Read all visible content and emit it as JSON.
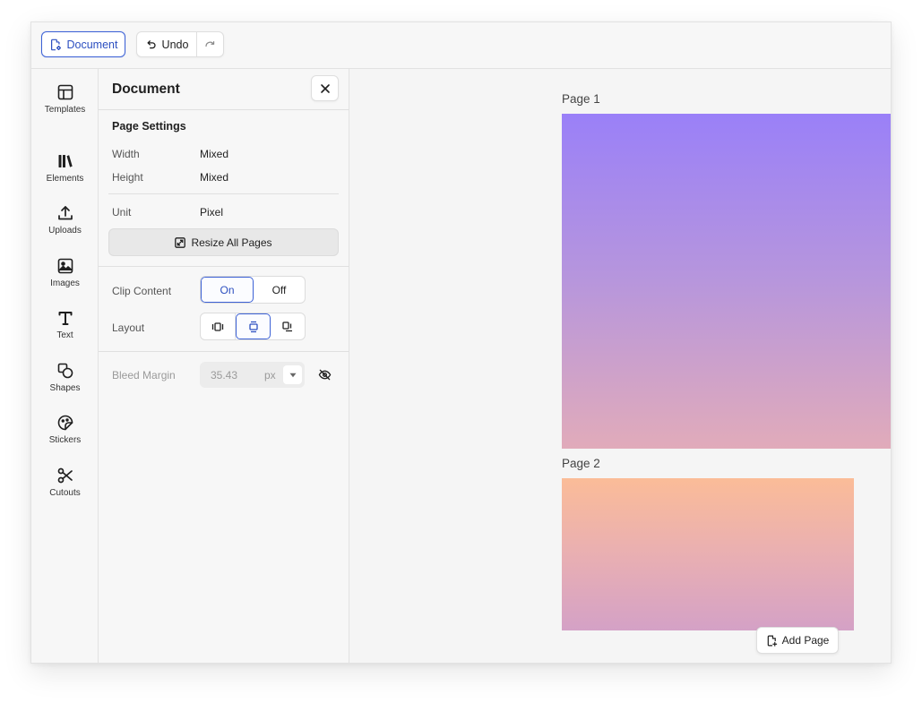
{
  "toolbar": {
    "document_label": "Document",
    "undo_label": "Undo"
  },
  "rail": {
    "items": [
      {
        "label": "Templates",
        "icon": "layout-icon"
      },
      {
        "label": "Elements",
        "icon": "library-icon"
      },
      {
        "label": "Uploads",
        "icon": "upload-icon"
      },
      {
        "label": "Images",
        "icon": "image-icon"
      },
      {
        "label": "Text",
        "icon": "text-icon"
      },
      {
        "label": "Shapes",
        "icon": "shapes-icon"
      },
      {
        "label": "Stickers",
        "icon": "sticker-icon"
      },
      {
        "label": "Cutouts",
        "icon": "scissors-icon"
      }
    ]
  },
  "panel": {
    "title": "Document",
    "page_settings": {
      "title": "Page Settings",
      "width_label": "Width",
      "width_value": "Mixed",
      "height_label": "Height",
      "height_value": "Mixed",
      "unit_label": "Unit",
      "unit_value": "Pixel",
      "resize_label": "Resize All Pages"
    },
    "clip_content": {
      "label": "Clip Content",
      "on_label": "On",
      "off_label": "Off",
      "selected": "On"
    },
    "layout": {
      "label": "Layout",
      "options": [
        "layout-horizontal-icon",
        "layout-vertical-icon",
        "layout-free-icon"
      ],
      "selected": 1
    },
    "bleed": {
      "label": "Bleed Margin",
      "value": "35.43",
      "unit": "px"
    }
  },
  "canvas": {
    "pages": [
      {
        "label": "Page 1"
      },
      {
        "label": "Page 2"
      }
    ],
    "add_page_label": "Add Page"
  },
  "colors": {
    "accent": "#3d62d6",
    "page1_top": "#9a80f8",
    "page1_bottom": "#e1abba",
    "page2_top": "#fbbc98",
    "page2_bottom": "#d4a1c6"
  }
}
